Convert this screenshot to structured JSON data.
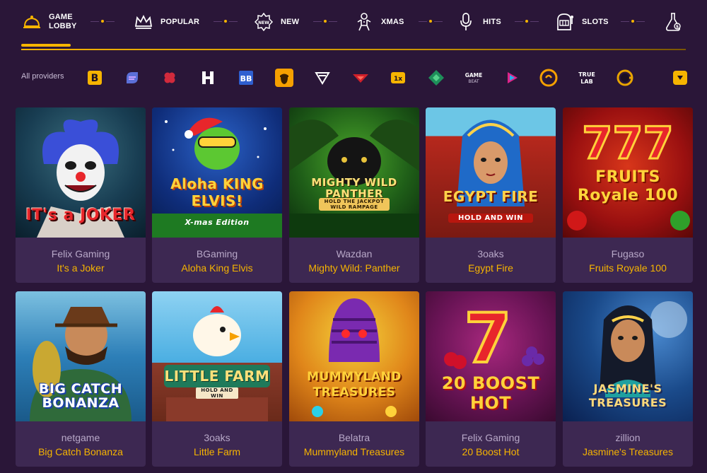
{
  "nav": {
    "items": [
      {
        "label_line1": "GAME",
        "label_line2": "LOBBY",
        "icon": "bell-icon",
        "active": true
      },
      {
        "label": "POPULAR",
        "icon": "crown-icon"
      },
      {
        "label": "NEW",
        "icon": "new-badge-icon"
      },
      {
        "label": "XMAS",
        "icon": "gingerbread-icon"
      },
      {
        "label": "HITS",
        "icon": "microphone-icon"
      },
      {
        "label": "SLOTS",
        "icon": "slot-machine-icon"
      },
      {
        "label": "",
        "icon": "potion-flask-icon"
      }
    ],
    "accent": "#f6b400"
  },
  "providers": {
    "all_label": "All providers",
    "logos": [
      {
        "icon": "provider-b-logo",
        "text": "B"
      },
      {
        "icon": "provider-swirl-logo",
        "text": ""
      },
      {
        "icon": "provider-clover-logo",
        "text": ""
      },
      {
        "icon": "provider-h-logo",
        "text": "H"
      },
      {
        "icon": "provider-bb-logo",
        "text": "BB"
      },
      {
        "icon": "provider-acorn-logo",
        "text": ""
      },
      {
        "icon": "provider-v-logo",
        "text": ""
      },
      {
        "icon": "provider-red-wing-logo",
        "text": ""
      },
      {
        "icon": "provider-dark-logo",
        "text": ""
      },
      {
        "icon": "provider-diamond-logo",
        "text": ""
      },
      {
        "icon": "provider-gamebeat-logo",
        "text": "GAME BEAT"
      },
      {
        "icon": "provider-play-logo",
        "text": ""
      },
      {
        "icon": "provider-orange-circle-logo",
        "text": ""
      },
      {
        "icon": "provider-truelab-logo",
        "text": "TRUE LAB"
      },
      {
        "icon": "provider-g-logo",
        "text": "G"
      }
    ],
    "dropdown_icon": "chevron-down-icon"
  },
  "games": [
    {
      "provider": "Felix Gaming",
      "title": "It's a Joker",
      "art_text": "IT's a JOKER",
      "colors": [
        "#0f3b4a",
        "#163a58"
      ],
      "title_color": "#e8262b"
    },
    {
      "provider": "BGaming",
      "title": "Aloha King Elvis",
      "art_text": "Aloha KING ELVIS!",
      "art_sub": "X-mas Edition",
      "colors": [
        "#0b2a6b",
        "#1b4da8"
      ],
      "title_color": "#ffd23a"
    },
    {
      "provider": "Wazdan",
      "title": "Mighty Wild: Panther",
      "art_text": "MIGHTY WILD PANTHER",
      "art_sub": "HOLD THE JACKPOT WILD RAMPAGE",
      "colors": [
        "#0e3a12",
        "#2f7a1e"
      ],
      "title_color": "#ffe27a"
    },
    {
      "provider": "3oaks",
      "title": "Egypt Fire",
      "art_text": "EGYPT FIRE",
      "art_sub": "HOLD AND WIN",
      "colors": [
        "#b6281d",
        "#6cc6e6"
      ],
      "title_color": "#ffd24a"
    },
    {
      "provider": "Fugaso",
      "title": "Fruits Royale 100",
      "art_text": "FRUITS Royale 100",
      "colors": [
        "#8a1010",
        "#c12512"
      ],
      "title_color": "#ffd43a"
    },
    {
      "provider": "netgame",
      "title": "Big Catch Bonanza",
      "art_text": "BIG CATCH BONANZA",
      "colors": [
        "#1c6aa8",
        "#6cb1d9"
      ],
      "title_color": "#ffffff"
    },
    {
      "provider": "3oaks",
      "title": "Little Farm",
      "art_text": "LITTLE FARM",
      "art_sub": "HOLD AND WIN",
      "colors": [
        "#3aa6e0",
        "#7cc8ee"
      ],
      "title_color": "#ffe07a"
    },
    {
      "provider": "Belatra",
      "title": "Mummyland Treasures",
      "art_text": "MUMMYLAND TREASURES",
      "colors": [
        "#e08a1a",
        "#f4c42a"
      ],
      "title_color": "#ffd23a"
    },
    {
      "provider": "Felix Gaming",
      "title": "20 Boost Hot",
      "art_text": "20 BOOST HOT",
      "colors": [
        "#5a0f4a",
        "#8f1f6e"
      ],
      "title_color": "#ffd23a"
    },
    {
      "provider": "zillion",
      "title": "Jasmine's Treasures",
      "art_text": "JASMINE'S TREASURES",
      "colors": [
        "#0d2f5e",
        "#2e6aa6"
      ],
      "title_color": "#ffd97a"
    }
  ]
}
